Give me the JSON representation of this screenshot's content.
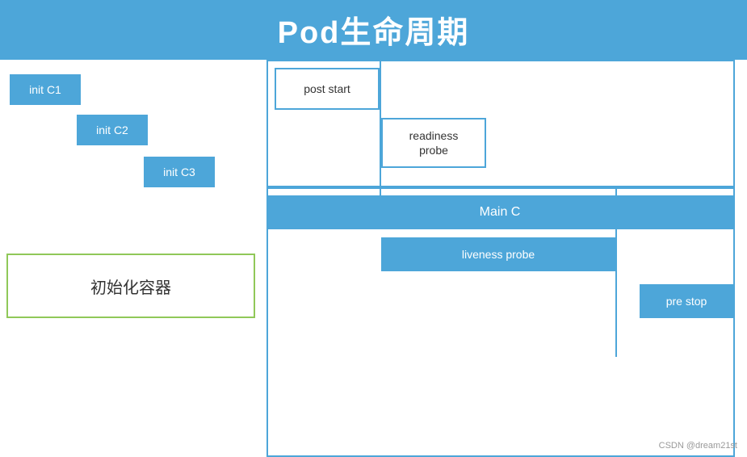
{
  "title": "Pod生命周期",
  "blocks": {
    "init_c1": "init C1",
    "init_c2": "init C2",
    "init_c3": "init C3",
    "post_start": "post start",
    "readiness_probe": "readiness\nprobe",
    "main_c": "Main C",
    "liveness_probe": "liveness probe",
    "pre_stop": "pre stop",
    "init_container": "初始化容器"
  },
  "watermark": "CSDN @dream21st",
  "colors": {
    "blue": "#4da6d9",
    "green_border": "#90c858",
    "white": "#ffffff",
    "text_dark": "#333333",
    "text_light": "#ffffff"
  }
}
